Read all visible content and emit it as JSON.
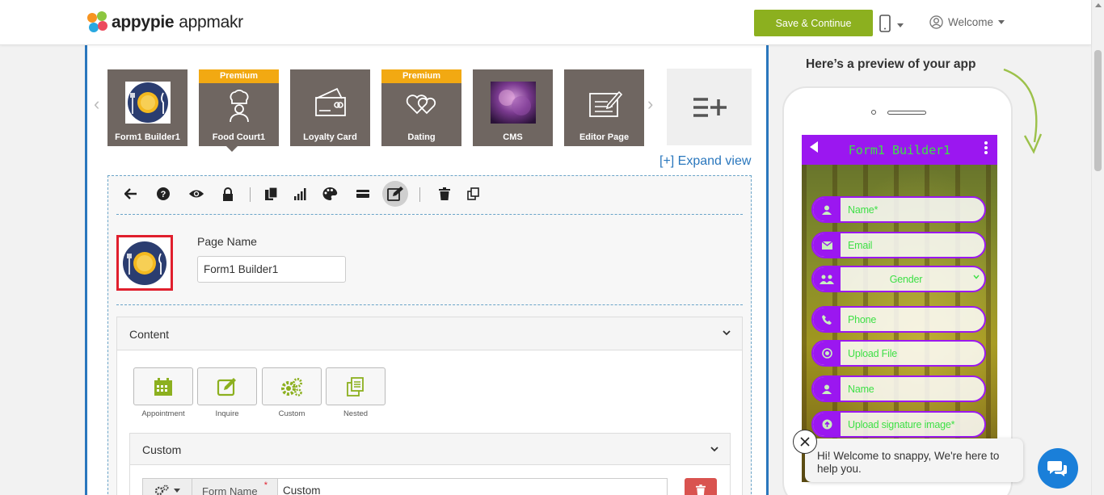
{
  "header": {
    "logo_brand": "appypie",
    "logo_product": "appmakr",
    "save_label": "Save & Continue",
    "welcome_label": "Welcome"
  },
  "pages": [
    {
      "label": "Form1 Builder1",
      "premium": "",
      "icon": "food-plate-icon"
    },
    {
      "label": "Food Court1",
      "premium": "Premium",
      "icon": "chef-icon"
    },
    {
      "label": "Loyalty Card",
      "premium": "",
      "icon": "loyalty-card-icon"
    },
    {
      "label": "Dating",
      "premium": "Premium",
      "icon": "hearts-icon"
    },
    {
      "label": "CMS",
      "premium": "",
      "icon": "cms-image-icon"
    },
    {
      "label": "Editor Page",
      "premium": "",
      "icon": "editor-icon"
    }
  ],
  "expand_view": "[+] Expand view",
  "page_settings": {
    "page_name_label": "Page Name",
    "page_name_value": "Form1 Builder1"
  },
  "content": {
    "heading": "Content",
    "features": [
      "Appointment",
      "Inquire",
      "Custom",
      "Nested"
    ],
    "custom_heading": "Custom",
    "form_name_label": "Form Name",
    "form_name_required": "*",
    "form_name_value": "Custom"
  },
  "preview": {
    "title": "Here’s a preview of your app",
    "app_title": "Form1 Builder1",
    "fields": [
      "Name*",
      "Email",
      "Gender",
      "Phone",
      "Upload File",
      "Name",
      "Upload signature image*"
    ]
  },
  "chat": {
    "message": "Hi! Welcome to snappy, We're here to help you."
  },
  "colors": {
    "accent_green": "#8cb01f",
    "brand_blue": "#2a77bd",
    "tile_brown": "#6f6661",
    "premium_orange": "#f2a912",
    "app_purple": "#9b17f0",
    "app_text_green": "#3ee046"
  }
}
